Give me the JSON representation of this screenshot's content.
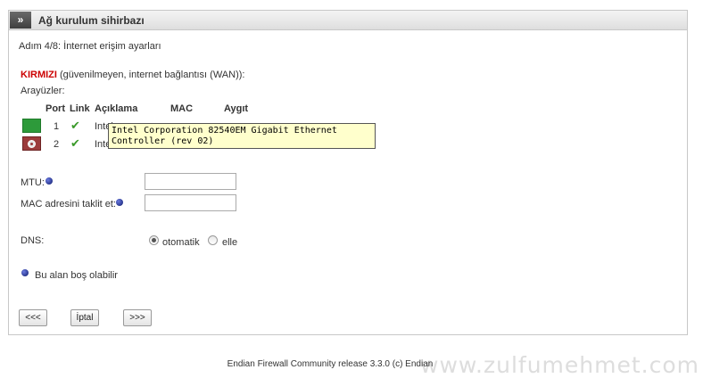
{
  "header": {
    "toggle_label": "»",
    "title": "Ağ kurulum sihirbazı"
  },
  "step_text": "Adım 4/8: İnternet erişim ayarları",
  "zone": {
    "name": "KIRMIZI",
    "desc": " (güvenilmeyen, internet bağlantısı (WAN)):"
  },
  "interfaces_label": "Arayüzler:",
  "table": {
    "headers": {
      "port": "Port",
      "link": "Link",
      "desc": "Açıklama",
      "mac": "MAC",
      "device": "Aygıt"
    },
    "rows": [
      {
        "port": "1",
        "desc": "Intel",
        "status_color": "#2d9a3a"
      },
      {
        "port": "2",
        "desc": "Intel",
        "status_color": "#9b3b3b"
      }
    ]
  },
  "tooltip": "Intel Corporation 82540EM Gigabit Ethernet Controller (rev 02)",
  "mtu": {
    "label": "MTU:",
    "value": ""
  },
  "mac_spoof": {
    "label": "MAC adresini taklit et:",
    "value": ""
  },
  "dns": {
    "label": "DNS:",
    "options": [
      "otomatik",
      "elle"
    ],
    "selected": "otomatik"
  },
  "note": "Bu alan boş olabilir",
  "buttons": {
    "back": "<<<",
    "cancel": "İptal",
    "next": ">>>"
  },
  "footer": "Endian Firewall Community release 3.3.0 (c) Endian",
  "watermark": "www.zulfumehmet.com",
  "colors": {
    "zone_red": "#cc0000",
    "link_ok": "#3a9a2a",
    "tooltip_bg": "#ffffcc"
  }
}
